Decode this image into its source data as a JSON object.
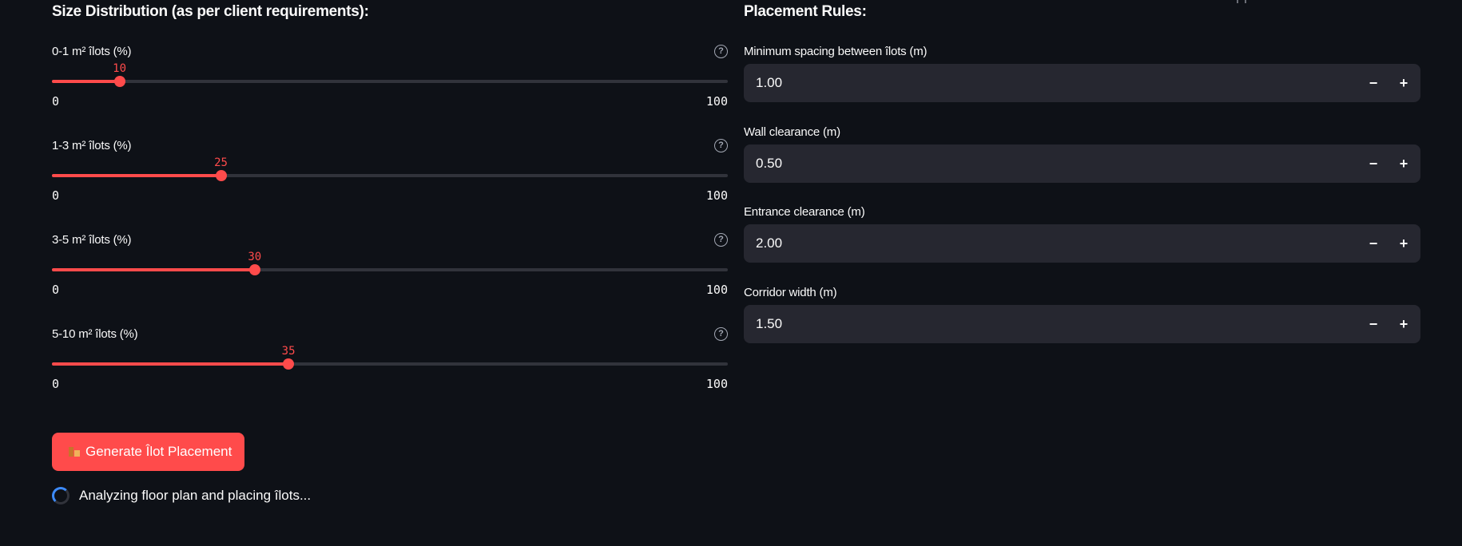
{
  "left": {
    "title": "Size Distribution (as per client requirements):",
    "sliders": [
      {
        "label": "0-1 m² îlots (%)",
        "value": "10",
        "min": "0",
        "max": "100",
        "fraction": 0.1
      },
      {
        "label": "1-3 m² îlots (%)",
        "value": "25",
        "min": "0",
        "max": "100",
        "fraction": 0.25
      },
      {
        "label": "3-5 m² îlots (%)",
        "value": "30",
        "min": "0",
        "max": "100",
        "fraction": 0.3
      },
      {
        "label": "5-10 m² îlots (%)",
        "value": "35",
        "min": "0",
        "max": "100",
        "fraction": 0.35
      }
    ],
    "generate_label": "Generate Îlot Placement",
    "status_text": "Analyzing floor plan and placing îlots..."
  },
  "right": {
    "title": "Placement Rules:",
    "inputs": [
      {
        "label": "Minimum spacing between îlots (m)",
        "value": "1.00"
      },
      {
        "label": "Wall clearance (m)",
        "value": "0.50"
      },
      {
        "label": "Entrance clearance (m)",
        "value": "2.00"
      },
      {
        "label": "Corridor width (m)",
        "value": "1.50"
      }
    ]
  },
  "icons": {
    "help": "question-circle-icon",
    "step_minus": "minus-icon",
    "step_plus": "plus-icon",
    "generate": "building-blocks-icon",
    "status": "spinner-icon"
  },
  "colors": {
    "background": "#0e1117",
    "accent": "#ff4b4b",
    "track": "#31333b",
    "input_bg": "#262730",
    "spinner": "#3d8bfd"
  }
}
